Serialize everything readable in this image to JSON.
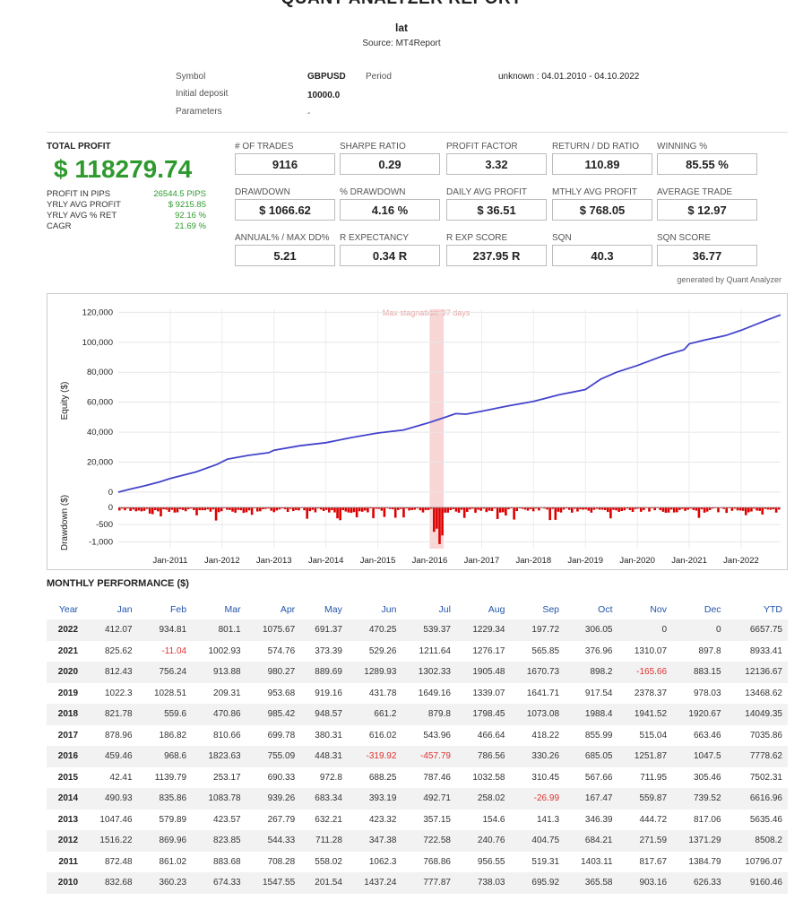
{
  "header": {
    "title": "QUANT ANALYZER REPORT",
    "subtitle": "lat",
    "source": "Source: MT4Report"
  },
  "info": {
    "symbol_label": "Symbol",
    "symbol_value": "GBPUSD",
    "period_label": "Period",
    "period_value": "unknown : 04.01.2010 - 04.10.2022",
    "deposit_label": "Initial deposit",
    "deposit_value": "10000.0",
    "params_label": "Parameters",
    "params_value": "-"
  },
  "total": {
    "label": "TOTAL PROFIT",
    "value": "$ 118279.74",
    "rows": [
      {
        "label": "PROFIT IN PIPS",
        "value": "26544.5 PIPS"
      },
      {
        "label": "YRLY AVG PROFIT",
        "value": "$ 9215.85"
      },
      {
        "label": "YRLY AVG % RET",
        "value": "92.16 %"
      },
      {
        "label": "CAGR",
        "value": "21.69 %"
      }
    ]
  },
  "stats": [
    {
      "label": "# OF TRADES",
      "value": "9116"
    },
    {
      "label": "SHARPE RATIO",
      "value": "0.29"
    },
    {
      "label": "PROFIT FACTOR",
      "value": "3.32"
    },
    {
      "label": "RETURN / DD RATIO",
      "value": "110.89"
    },
    {
      "label": "WINNING %",
      "value": "85.55 %"
    },
    {
      "label": "DRAWDOWN",
      "value": "$ 1066.62"
    },
    {
      "label": "% DRAWDOWN",
      "value": "4.16 %"
    },
    {
      "label": "DAILY AVG PROFIT",
      "value": "$ 36.51"
    },
    {
      "label": "MTHLY AVG PROFIT",
      "value": "$ 768.05"
    },
    {
      "label": "AVERAGE TRADE",
      "value": "$ 12.97"
    },
    {
      "label": "ANNUAL% / MAX DD%",
      "value": "5.21"
    },
    {
      "label": "R EXPECTANCY",
      "value": "0.34 R"
    },
    {
      "label": "R EXP SCORE",
      "value": "237.95 R"
    },
    {
      "label": "SQN",
      "value": "40.3"
    },
    {
      "label": "SQN SCORE",
      "value": "36.77"
    }
  ],
  "generated_by": "generated by Quant Analyzer",
  "chart_data": {
    "type": "line",
    "title": "",
    "annotation": "Max stagnation: 97 days",
    "stagnation_range": [
      2016.0,
      2016.27
    ],
    "equity": {
      "ylabel": "Equity ($)",
      "ylim": [
        0,
        122000
      ],
      "yticks": [
        "0",
        "20,000",
        "40,000",
        "60,000",
        "80,000",
        "100,000",
        "120,000"
      ],
      "ytick_values": [
        0,
        20000,
        40000,
        60000,
        80000,
        100000,
        120000
      ],
      "line_color": "#4444cc",
      "points": [
        [
          2010.0,
          0
        ],
        [
          2010.2,
          1800
        ],
        [
          2010.5,
          4200
        ],
        [
          2010.8,
          6900
        ],
        [
          2011.0,
          9100
        ],
        [
          2011.5,
          13500
        ],
        [
          2011.9,
          18500
        ],
        [
          2012.1,
          22000
        ],
        [
          2012.5,
          24500
        ],
        [
          2012.9,
          26400
        ],
        [
          2013.0,
          28000
        ],
        [
          2013.5,
          31000
        ],
        [
          2014.0,
          33000
        ],
        [
          2014.5,
          36500
        ],
        [
          2015.0,
          39500
        ],
        [
          2015.5,
          41500
        ],
        [
          2015.9,
          45500
        ],
        [
          2016.0,
          46500
        ],
        [
          2016.3,
          50000
        ],
        [
          2016.5,
          52400
        ],
        [
          2016.7,
          52000
        ],
        [
          2017.0,
          54000
        ],
        [
          2017.5,
          57500
        ],
        [
          2018.0,
          60500
        ],
        [
          2018.5,
          65000
        ],
        [
          2019.0,
          68500
        ],
        [
          2019.3,
          75500
        ],
        [
          2019.6,
          80000
        ],
        [
          2020.0,
          84500
        ],
        [
          2020.5,
          91000
        ],
        [
          2020.9,
          95000
        ],
        [
          2021.0,
          99000
        ],
        [
          2021.3,
          101500
        ],
        [
          2021.7,
          104500
        ],
        [
          2022.0,
          108000
        ],
        [
          2022.4,
          113500
        ],
        [
          2022.76,
          118280
        ]
      ]
    },
    "drawdown": {
      "ylabel": "Drawdown ($)",
      "ylim": [
        -1200,
        0
      ],
      "yticks": [
        "0",
        "-500",
        "-1,000"
      ],
      "ytick_values": [
        0,
        -500,
        -1000
      ],
      "bar_color": "#dd0000",
      "max_drawdown": -1066.62,
      "max_drawdown_x": 2016.15
    },
    "xlim": [
      2010.0,
      2022.76
    ],
    "xticks": [
      "Jan-2011",
      "Jan-2012",
      "Jan-2013",
      "Jan-2014",
      "Jan-2015",
      "Jan-2016",
      "Jan-2017",
      "Jan-2018",
      "Jan-2019",
      "Jan-2020",
      "Jan-2021",
      "Jan-2022"
    ],
    "xtick_values": [
      2011,
      2012,
      2013,
      2014,
      2015,
      2016,
      2017,
      2018,
      2019,
      2020,
      2021,
      2022
    ]
  },
  "monthly": {
    "title": "MONTHLY PERFORMANCE ($)",
    "columns": [
      "Year",
      "Jan",
      "Feb",
      "Mar",
      "Apr",
      "May",
      "Jun",
      "Jul",
      "Aug",
      "Sep",
      "Oct",
      "Nov",
      "Dec",
      "YTD"
    ],
    "rows": [
      [
        "2022",
        "412.07",
        "934.81",
        "801.1",
        "1075.67",
        "691.37",
        "470.25",
        "539.37",
        "1229.34",
        "197.72",
        "306.05",
        "0",
        "0",
        "6657.75"
      ],
      [
        "2021",
        "825.62",
        "-11.04",
        "1002.93",
        "574.76",
        "373.39",
        "529.26",
        "1211.64",
        "1276.17",
        "565.85",
        "376.96",
        "1310.07",
        "897.8",
        "8933.41"
      ],
      [
        "2020",
        "812.43",
        "756.24",
        "913.88",
        "980.27",
        "889.69",
        "1289.93",
        "1302.33",
        "1905.48",
        "1670.73",
        "898.2",
        "-165.66",
        "883.15",
        "12136.67"
      ],
      [
        "2019",
        "1022.3",
        "1028.51",
        "209.31",
        "953.68",
        "919.16",
        "431.78",
        "1649.16",
        "1339.07",
        "1641.71",
        "917.54",
        "2378.37",
        "978.03",
        "13468.62"
      ],
      [
        "2018",
        "821.78",
        "559.6",
        "470.86",
        "985.42",
        "948.57",
        "661.2",
        "879.8",
        "1798.45",
        "1073.08",
        "1988.4",
        "1941.52",
        "1920.67",
        "14049.35"
      ],
      [
        "2017",
        "878.96",
        "186.82",
        "810.66",
        "699.78",
        "380.31",
        "616.02",
        "543.96",
        "466.64",
        "418.22",
        "855.99",
        "515.04",
        "663.46",
        "7035.86"
      ],
      [
        "2016",
        "459.46",
        "968.6",
        "1823.63",
        "755.09",
        "448.31",
        "-319.92",
        "-457.79",
        "786.56",
        "330.26",
        "685.05",
        "1251.87",
        "1047.5",
        "7778.62"
      ],
      [
        "2015",
        "42.41",
        "1139.79",
        "253.17",
        "690.33",
        "972.8",
        "688.25",
        "787.46",
        "1032.58",
        "310.45",
        "567.66",
        "711.95",
        "305.46",
        "7502.31"
      ],
      [
        "2014",
        "490.93",
        "835.86",
        "1083.78",
        "939.26",
        "683.34",
        "393.19",
        "492.71",
        "258.02",
        "-26.99",
        "167.47",
        "559.87",
        "739.52",
        "6616.96"
      ],
      [
        "2013",
        "1047.46",
        "579.89",
        "423.57",
        "267.79",
        "632.21",
        "423.32",
        "357.15",
        "154.6",
        "141.3",
        "346.39",
        "444.72",
        "817.06",
        "5635.46"
      ],
      [
        "2012",
        "1516.22",
        "869.96",
        "823.85",
        "544.33",
        "711.28",
        "347.38",
        "722.58",
        "240.76",
        "404.75",
        "684.21",
        "271.59",
        "1371.29",
        "8508.2"
      ],
      [
        "2011",
        "872.48",
        "861.02",
        "883.68",
        "708.28",
        "558.02",
        "1062.3",
        "768.86",
        "956.55",
        "519.31",
        "1403.11",
        "817.67",
        "1384.79",
        "10796.07"
      ],
      [
        "2010",
        "832.68",
        "360.23",
        "674.33",
        "1547.55",
        "201.54",
        "1437.24",
        "777.87",
        "738.03",
        "695.92",
        "365.58",
        "903.16",
        "626.33",
        "9160.46"
      ]
    ]
  }
}
